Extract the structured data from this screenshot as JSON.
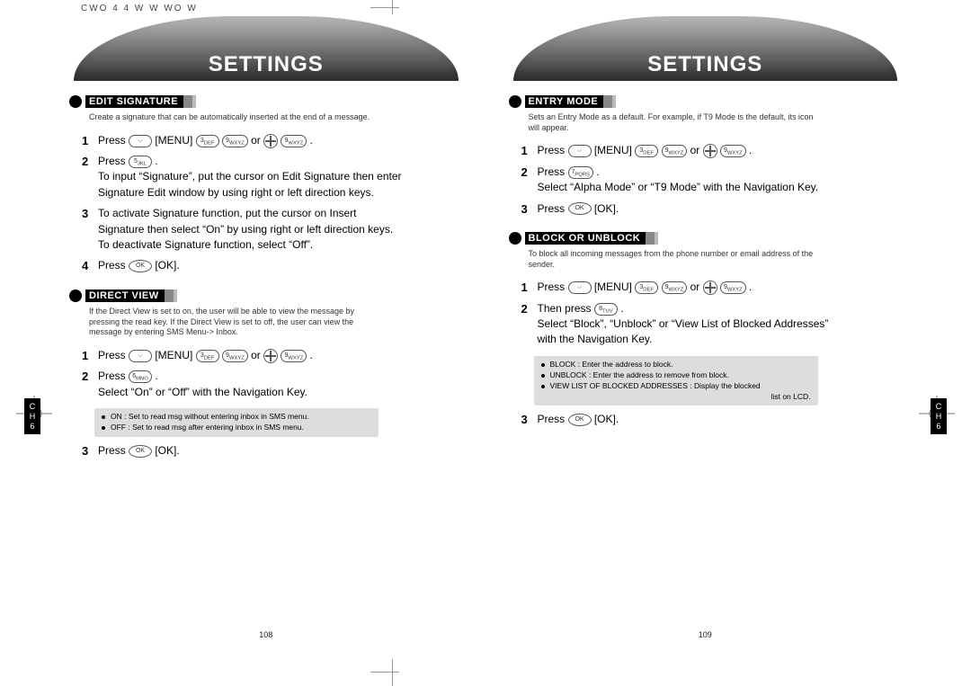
{
  "header_line": "CWO     4   4     W                  W        WO                W",
  "banner_left": "SETTINGS",
  "banner_right": "SETTINGS",
  "chapter_tab": "C\nH\n6",
  "page_left_num": "108",
  "page_right_num": "109",
  "edit_signature": {
    "title": "EDIT SIGNATURE",
    "desc": "Create a signature that can be automatically inserted at the end of a message.",
    "steps": [
      "Press ⌵ [MENU] 3DEF 9WXYZ or ⊕ 9WXYZ .",
      "Press 5JKL .\nTo input “Signature”, put the cursor on Edit Signature then enter Signature Edit window by using right or left direction keys.",
      "To activate Signature function, put the cursor on Insert Signature then select “On” by using right or left direction keys. To deactivate Signature function, select “Off”.",
      "Press OK [OK]."
    ]
  },
  "direct_view": {
    "title": "DIRECT VIEW",
    "desc": "If the Direct View is set to on, the user will be able to view the message by pressing the read key. If the Direct View is set to off, the user can view the message by entering SMS Menu-> Inbox.",
    "steps": [
      "Press ⌵ [MENU] 3DEF 9WXYZ or ⊕ 9WXYZ .",
      "Press 6MNO .\nSelect “On” or “Off” with the Navigation Key.",
      "Press OK [OK]."
    ],
    "list": [
      "ON : Set to read msg without entering inbox in SMS menu.",
      "OFF : Set to read msg after entering inbox in SMS menu."
    ]
  },
  "entry_mode": {
    "title": "ENTRY MODE",
    "desc": "Sets an Entry Mode as a default. For example, if T9 Mode is the default, its icon will appear.",
    "steps": [
      "Press ⌵ [MENU] 3DEF 9WXYZ or ⊕ 9WXYZ .",
      "Press 7PQRS .\nSelect  “Alpha Mode” or “T9 Mode” with the Navigation Key.",
      "Press OK [OK]."
    ]
  },
  "block": {
    "title": "BLOCK OR UNBLOCK",
    "desc": "To block all incoming messages from the phone number or email address of the sender.",
    "steps": [
      "Press ⌵ [MENU] 3DEF 9WXYZ or ⊕ 9WXYZ .",
      "Then press 8TUV .\nSelect “Block”, “Unblock” or “View List of Blocked Addresses” with the Navigation Key.",
      "Press OK [OK]."
    ],
    "list": [
      "BLOCK : Enter the address to block.",
      "UNBLOCK : Enter the address to remove from block.",
      "VIEW LIST OF BLOCKED ADDRESSES : Display the blocked list on LCD."
    ]
  }
}
